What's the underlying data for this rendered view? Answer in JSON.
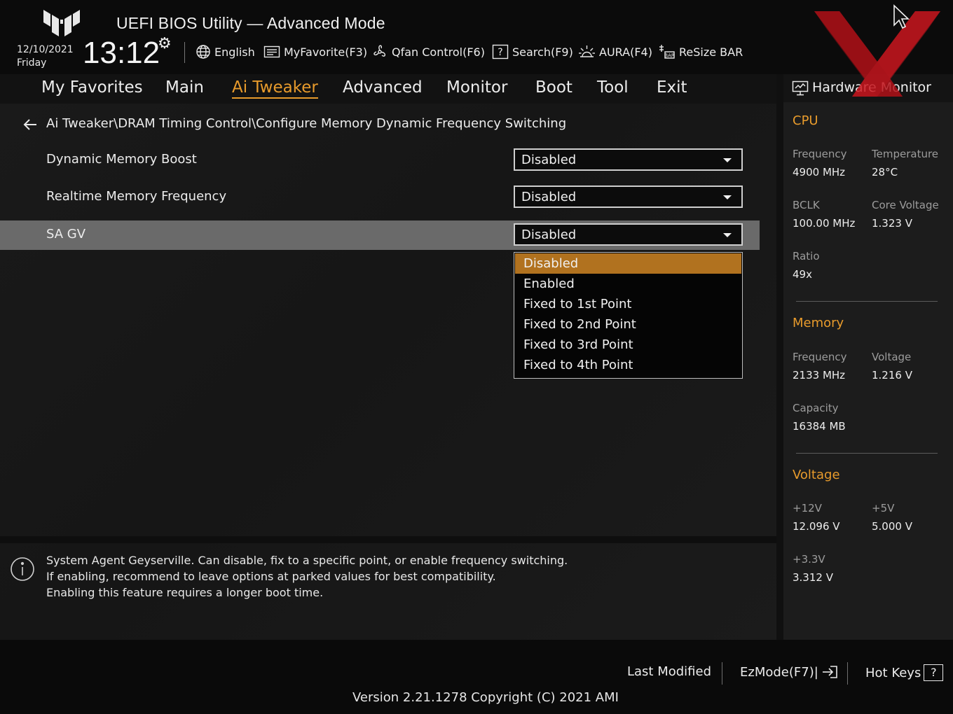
{
  "header": {
    "title": "UEFI BIOS Utility — Advanced Mode",
    "date": "12/10/2021",
    "day": "Friday",
    "time": "13:12",
    "toolbar": [
      {
        "label": "English",
        "icon": "globe-icon"
      },
      {
        "label": "MyFavorite(F3)",
        "icon": "favorite-icon"
      },
      {
        "label": "Qfan Control(F6)",
        "icon": "fan-icon"
      },
      {
        "label": "Search(F9)",
        "icon": "search-help-icon"
      },
      {
        "label": "AURA(F4)",
        "icon": "aura-icon"
      },
      {
        "label": "ReSize BAR",
        "icon": "resize-bar-icon"
      }
    ]
  },
  "nav": {
    "tabs": [
      {
        "label": "My Favorites",
        "active": false
      },
      {
        "label": "Main",
        "active": false
      },
      {
        "label": "Ai Tweaker",
        "active": true
      },
      {
        "label": "Advanced",
        "active": false
      },
      {
        "label": "Monitor",
        "active": false
      },
      {
        "label": "Boot",
        "active": false
      },
      {
        "label": "Tool",
        "active": false
      },
      {
        "label": "Exit",
        "active": false
      }
    ]
  },
  "breadcrumb": "Ai Tweaker\\DRAM Timing Control\\Configure Memory Dynamic Frequency Switching",
  "settings": [
    {
      "label": "Dynamic Memory Boost",
      "value": "Disabled",
      "selected": false
    },
    {
      "label": "Realtime Memory Frequency",
      "value": "Disabled",
      "selected": false
    },
    {
      "label": "SA GV",
      "value": "Disabled",
      "selected": true
    }
  ],
  "dropdown": {
    "options": [
      "Disabled",
      "Enabled",
      "Fixed to 1st Point",
      "Fixed to 2nd Point",
      "Fixed to 3rd Point",
      "Fixed to 4th Point"
    ],
    "highlighted": "Disabled"
  },
  "help": {
    "lines": [
      "System Agent Geyserville. Can disable, fix to a specific point, or enable frequency switching.",
      "If enabling, recommend to leave options at parked values for best compatibility.",
      "Enabling this feature requires a longer boot time."
    ]
  },
  "hw_monitor": {
    "title": "Hardware Monitor",
    "cpu": {
      "section": "CPU",
      "frequency_label": "Frequency",
      "frequency": "4900 MHz",
      "temperature_label": "Temperature",
      "temperature": "28°C",
      "bclk_label": "BCLK",
      "bclk": "100.00 MHz",
      "core_voltage_label": "Core Voltage",
      "core_voltage": "1.323 V",
      "ratio_label": "Ratio",
      "ratio": "49x"
    },
    "memory": {
      "section": "Memory",
      "frequency_label": "Frequency",
      "frequency": "2133 MHz",
      "voltage_label": "Voltage",
      "voltage": "1.216 V",
      "capacity_label": "Capacity",
      "capacity": "16384 MB"
    },
    "voltage": {
      "section": "Voltage",
      "v12_label": "+12V",
      "v12": "12.096 V",
      "v5_label": "+5V",
      "v5": "5.000 V",
      "v33_label": "+3.3V",
      "v33": "3.312 V"
    }
  },
  "footer": {
    "last_modified": "Last Modified",
    "ezmode": "EzMode(F7)|",
    "hotkeys": "Hot Keys",
    "hotkeys_key": "?",
    "version": "Version 2.21.1278 Copyright (C) 2021 AMI"
  },
  "colors": {
    "accent": "#e89b2c",
    "dropdown_highlight": "#b1721f",
    "selected_row": "#6a6a6a",
    "watermark_red": "#c8141c"
  }
}
